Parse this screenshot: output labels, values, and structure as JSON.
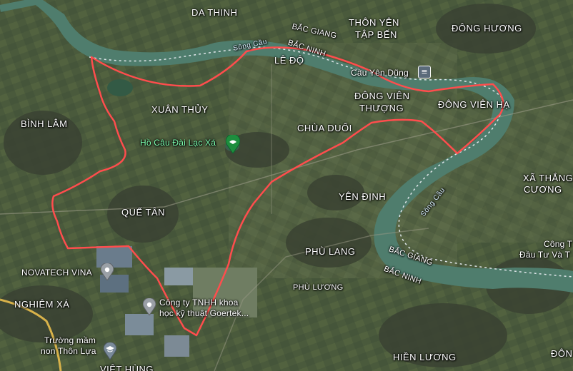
{
  "map": {
    "labels": {
      "da_thinh": "DA THINH",
      "thon_yen": "THÔN YÊN",
      "tap_ben": "TẬP BẾN",
      "dong_huong": "ĐÔNG HƯƠNG",
      "le_do": "LÊ ĐỘ",
      "xuan_thuy": "XUÂN THỦY",
      "binh_lam": "BÌNH LÂM",
      "chua_duoi": "CHÙA DUỐI",
      "dong_vien_thuong_1": "ĐÔNG VIÊN",
      "dong_vien_thuong_2": "THƯỢNG",
      "dong_vien_ha": "ĐÔNG VIÊN HẠ",
      "xa_thang_cuong_1": "XÃ THẮNG",
      "xa_thang_cuong_2": "CƯƠNG",
      "yen_dinh": "YÊN ĐỊNH",
      "que_tan": "QUẾ TÂN",
      "phu_lang": "PHÙ LANG",
      "phu_luong": "PHÙ LƯƠNG",
      "nghiem_xa": "NGHIÊM XÁ",
      "hien_luong": "HIỀN LƯƠNG",
      "viet_hung": "VIỆT HÙNG",
      "dong_edge": "ĐÔN"
    },
    "rivers": {
      "song_cau_1": "Sông Cầu",
      "song_cau_2": "Sông Cầu"
    },
    "boundaries": {
      "bac_giang_1": "BẮC GIANG",
      "bac_ninh_1": "BẮC NINH",
      "bac_giang_2": "BẮC GIANG",
      "bac_ninh_2": "BẮC NINH"
    },
    "pois": {
      "cau_yen_dung": "Cầu Yên Dũng",
      "ho_cau": "Hồ Câu Đài Lạc Xá",
      "novatech": "NOVATECH VINA",
      "goertek_1": "Công ty TNHH khoa",
      "goertek_2": "học kỹ thuật Goertek...",
      "truong_mam_non_1": "Trường mầm",
      "truong_mam_non_2": "non Thôn Lựa",
      "cong_ty_1": "Công T",
      "cong_ty_2": "Đầu Tư Và T"
    },
    "icons": [
      "place-pin-icon",
      "bridge-icon",
      "fishing-pond-icon",
      "school-icon"
    ],
    "colors": {
      "boundary": "#ff4d4d",
      "river": "#4f7d6d",
      "dashed_border": "#dfe6ea"
    }
  }
}
